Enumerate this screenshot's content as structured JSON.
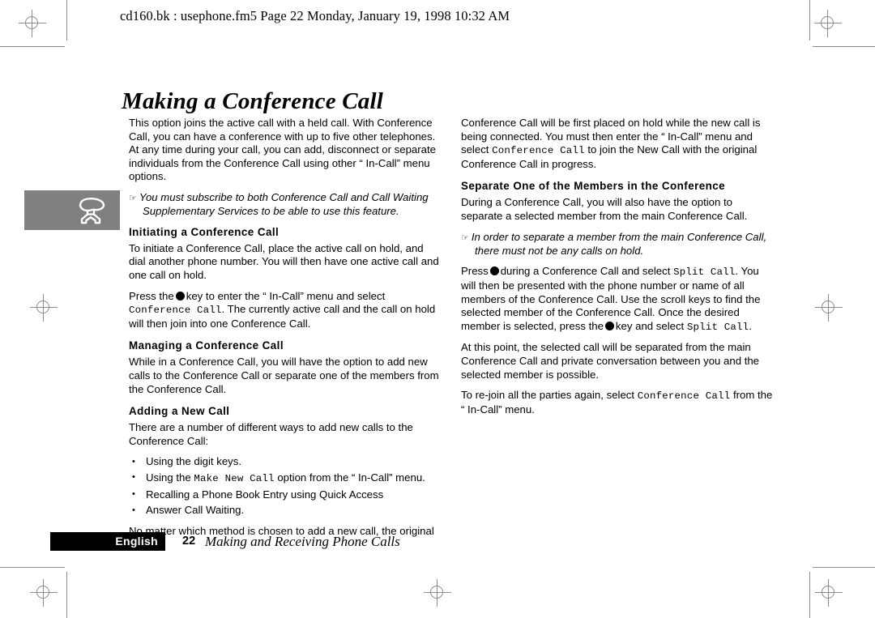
{
  "printer_marks": {
    "registration_icon": "registration-target",
    "positions": [
      "top-left",
      "top-right",
      "middle-left",
      "middle-right",
      "bottom-center",
      "bottom-left",
      "bottom-right"
    ]
  },
  "running_header": {
    "text": "cd160.bk : usephone.fm5  Page 22  Monday, January 19, 1998  10:32 AM"
  },
  "page_title": "Making a Conference Call",
  "note_icon_box": {
    "icon": "telephone-handset-icon",
    "background_color": "#808080",
    "icon_color": "#ffffff"
  },
  "left_column": {
    "intro_paragraph": "This option joins the active call with a held call. With Conference Call, you can have a conference with up to five other telephones. At any time during your call, you can add, disconnect or separate individuals from the Conference Call using other “ In-Call”  menu options.",
    "note": {
      "marker": "☞",
      "text": "You must subscribe to both Conference Call and Call Waiting Supplementary Services to be able to use this feature."
    },
    "heading_initiating": "Initiating a Conference Call",
    "initiating_paragraph": "To initiate a Conference Call, place the active call on hold, and dial another phone number. You will then have one active call and one call on hold.",
    "press_key": {
      "before": "Press the",
      "key_glyph": "●",
      "after": "key to enter the “ In-Call”  menu and select",
      "menu_item": "Conference Call",
      "tail": ". The currently active call and the call on hold will then join into one Conference Call."
    },
    "heading_managing": "Managing a Conference Call",
    "managing_paragraph": "While in a Conference Call, you will have the option to add new calls to the Conference Call or separate one of the members from the Conference Call.",
    "heading_adding": "Adding a New Call",
    "adding_paragraph": "There are a number of different ways to add new calls to the Conference Call:",
    "bullets": [
      {
        "text": "Using the digit keys."
      },
      {
        "before": "Using the",
        "mono": "Make New Call",
        "after": "option from the “ In-Call”  menu."
      },
      {
        "text": "Recalling a Phone Book Entry using Quick Access"
      },
      {
        "text": "Answer Call Waiting."
      }
    ],
    "closing_paragraph": "No matter which method is chosen to add a new call, the original"
  },
  "right_column": {
    "continued_before": "Conference Call will be first placed on hold while the new call is being connected. You must then enter the “ In-Call”  menu and select",
    "continued_mono": "Conference Call",
    "continued_after": "to join the New Call with the original Conference Call in progress.",
    "heading_separate": "Separate One of the Members in the Conference",
    "separate_paragraph": "During a Conference Call, you will also have the option to separate a selected member from the main Conference Call.",
    "note": {
      "marker": "☞",
      "text": "In order to separate a member from the main Conference Call, there must not be any calls on hold."
    },
    "press_split": {
      "p1": "Press",
      "key_glyph": "●",
      "p2": "during a Conference Call and select",
      "mono1": "Split Call",
      "p3": ". You will then be presented with the phone number or name of all members of the Conference Call. Use the scroll keys to find the selected member of the Conference Call. Once the desired member is selected, press the",
      "p4": "key and select",
      "mono2": "Split Call",
      "p5": "."
    },
    "at_this_point_paragraph": "At this point, the selected call will be separated from the main Conference Call and private conversation between you and the selected member is possible.",
    "rejoin": {
      "before": "To re-join all the parties again, select",
      "mono": "Conference Call",
      "after": "from the “ In-Call”  menu."
    }
  },
  "footer": {
    "language": "English",
    "page_number": "22",
    "section_title": "Making and Receiving Phone Calls",
    "bar_color": "#000000"
  }
}
